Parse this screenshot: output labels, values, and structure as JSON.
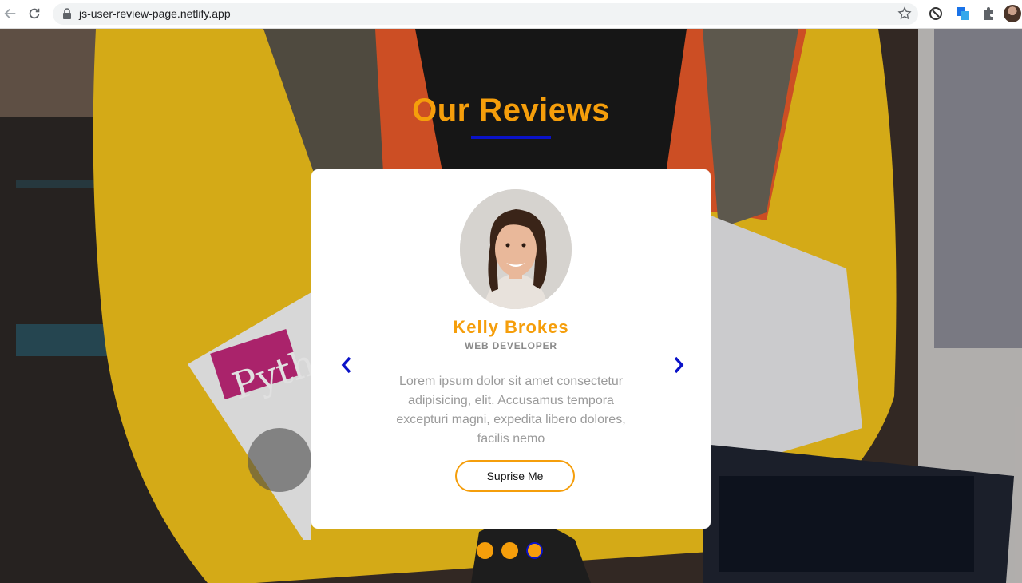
{
  "browser": {
    "url": "js-user-review-page.netlify.app",
    "icons": [
      "back-arrow-icon",
      "reload-icon",
      "lock-icon",
      "star-icon",
      "extension-icon",
      "puzzle-icon",
      "profile-avatar"
    ]
  },
  "page": {
    "title": "Our Reviews",
    "colors": {
      "accent": "#f59e0b",
      "underline": "#0a12c8",
      "card": "#ffffff",
      "text": "#9a9a9a"
    }
  },
  "review": {
    "name": "Kelly Brokes",
    "job": "WEB DEVELOPER",
    "text": "Lorem ipsum dolor sit amet consectetur adipisicing, elit. Accusamus tempora excepturi magni, expedita libero dolores, facilis nemo",
    "button_label": "Suprise Me"
  },
  "pagination": {
    "count": 3,
    "active_index": 2
  }
}
